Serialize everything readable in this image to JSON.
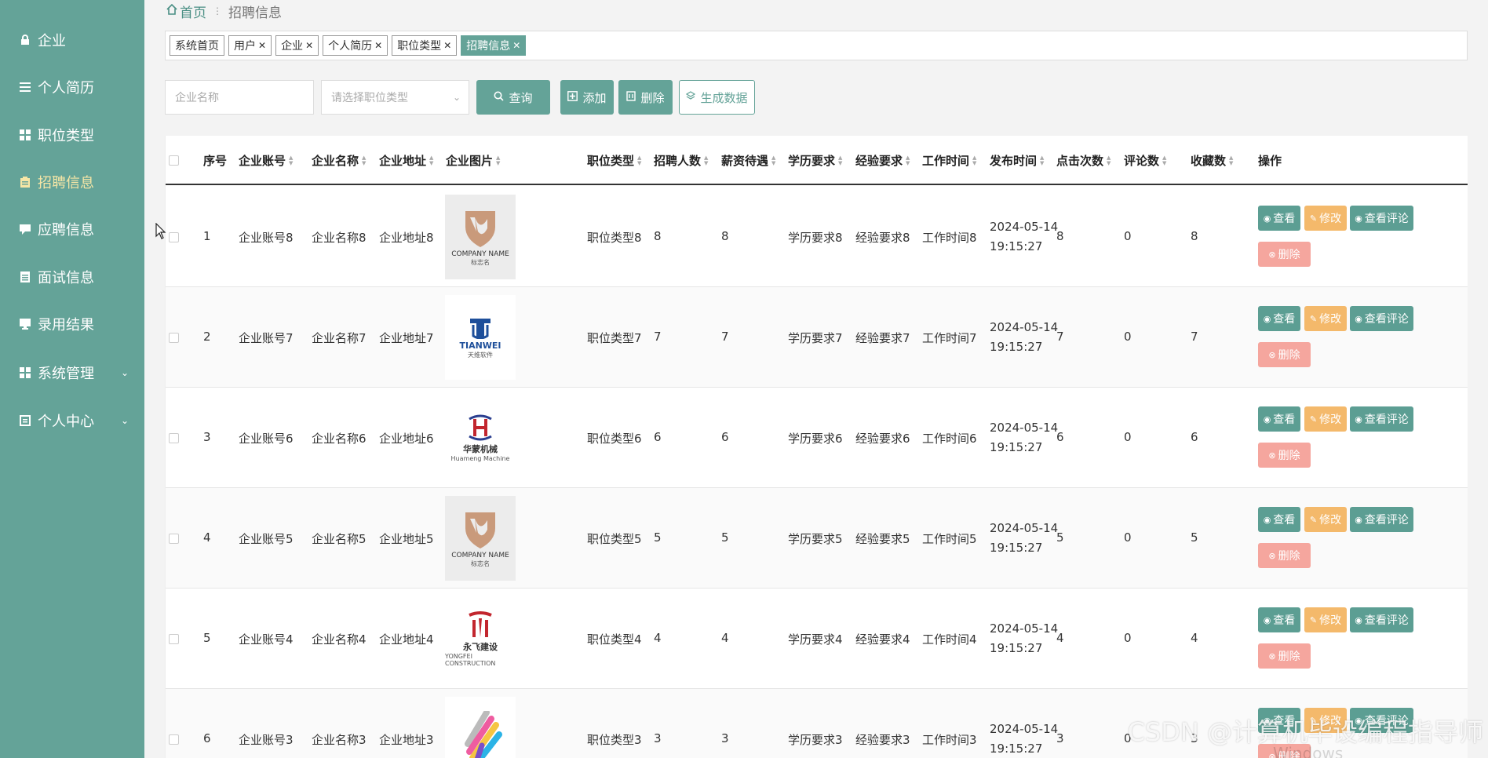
{
  "sidebar": {
    "items": [
      {
        "label": "企业",
        "icon": "lock-icon",
        "active": false
      },
      {
        "label": "个人简历",
        "icon": "list-icon",
        "active": false
      },
      {
        "label": "职位类型",
        "icon": "grid-icon",
        "active": false
      },
      {
        "label": "招聘信息",
        "icon": "clipboard-icon",
        "active": true
      },
      {
        "label": "应聘信息",
        "icon": "message-icon",
        "active": false
      },
      {
        "label": "面试信息",
        "icon": "document-icon",
        "active": false
      },
      {
        "label": "录用结果",
        "icon": "monitor-icon",
        "active": false
      },
      {
        "label": "系统管理",
        "icon": "grid-icon",
        "active": false,
        "expandable": true
      },
      {
        "label": "个人中心",
        "icon": "user-card-icon",
        "active": false,
        "expandable": true
      }
    ]
  },
  "breadcrumb": {
    "home": "首页",
    "current": "招聘信息"
  },
  "tags": [
    {
      "label": "系统首页",
      "closable": false,
      "active": false
    },
    {
      "label": "用户",
      "closable": true,
      "active": false
    },
    {
      "label": "企业",
      "closable": true,
      "active": false
    },
    {
      "label": "个人简历",
      "closable": true,
      "active": false
    },
    {
      "label": "职位类型",
      "closable": true,
      "active": false
    },
    {
      "label": "招聘信息",
      "closable": true,
      "active": true
    }
  ],
  "filters": {
    "company_placeholder": "企业名称",
    "type_placeholder": "请选择职位类型"
  },
  "buttons": {
    "search": "查询",
    "add": "添加",
    "delete": "删除",
    "generate": "生成数据"
  },
  "table": {
    "headers": {
      "index": "序号",
      "account": "企业账号",
      "name": "企业名称",
      "address": "企业地址",
      "image": "企业图片",
      "jobtype": "职位类型",
      "count": "招聘人数",
      "salary": "薪资待遇",
      "education": "学历要求",
      "experience": "经验要求",
      "worktime": "工作时间",
      "publish": "发布时间",
      "clicks": "点击次数",
      "comments": "评论数",
      "favorites": "收藏数",
      "ops": "操作"
    },
    "actions": {
      "view": "查看",
      "edit": "修改",
      "comment": "查看评论",
      "delete": "删除"
    },
    "rows": [
      {
        "index": "1",
        "account": "企业账号8",
        "name": "企业名称8",
        "address": "企业地址8",
        "logo": {
          "kind": "shield",
          "line1": "COMPANY NAME",
          "line2": "标志名"
        },
        "jobtype": "职位类型8",
        "count": "8",
        "salary": "8",
        "education": "学历要求8",
        "experience": "经验要求8",
        "worktime": "工作时间8",
        "publish": "2024-05-14 19:15:27",
        "clicks": "8",
        "comments": "0",
        "favorites": "8"
      },
      {
        "index": "2",
        "account": "企业账号7",
        "name": "企业名称7",
        "address": "企业地址7",
        "logo": {
          "kind": "tianwei",
          "line1": "TIANWEI",
          "line2": "天维软件"
        },
        "jobtype": "职位类型7",
        "count": "7",
        "salary": "7",
        "education": "学历要求7",
        "experience": "经验要求7",
        "worktime": "工作时间7",
        "publish": "2024-05-14 19:15:27",
        "clicks": "7",
        "comments": "0",
        "favorites": "7"
      },
      {
        "index": "3",
        "account": "企业账号6",
        "name": "企业名称6",
        "address": "企业地址6",
        "logo": {
          "kind": "huameng",
          "line1": "华蒙机械",
          "line2": "Huameng Machine"
        },
        "jobtype": "职位类型6",
        "count": "6",
        "salary": "6",
        "education": "学历要求6",
        "experience": "经验要求6",
        "worktime": "工作时间6",
        "publish": "2024-05-14 19:15:27",
        "clicks": "6",
        "comments": "0",
        "favorites": "6"
      },
      {
        "index": "4",
        "account": "企业账号5",
        "name": "企业名称5",
        "address": "企业地址5",
        "logo": {
          "kind": "shield",
          "line1": "COMPANY NAME",
          "line2": "标志名"
        },
        "jobtype": "职位类型5",
        "count": "5",
        "salary": "5",
        "education": "学历要求5",
        "experience": "经验要求5",
        "worktime": "工作时间5",
        "publish": "2024-05-14 19:15:27",
        "clicks": "5",
        "comments": "0",
        "favorites": "5"
      },
      {
        "index": "5",
        "account": "企业账号4",
        "name": "企业名称4",
        "address": "企业地址4",
        "logo": {
          "kind": "yongfei",
          "line1": "永飞建设",
          "line2": "YONGFEI CONSTRUCTION"
        },
        "jobtype": "职位类型4",
        "count": "4",
        "salary": "4",
        "education": "学历要求4",
        "experience": "经验要求4",
        "worktime": "工作时间4",
        "publish": "2024-05-14 19:15:27",
        "clicks": "4",
        "comments": "0",
        "favorites": "4"
      },
      {
        "index": "6",
        "account": "企业账号3",
        "name": "企业名称3",
        "address": "企业地址3",
        "logo": {
          "kind": "feather",
          "line1": "",
          "line2": ""
        },
        "jobtype": "职位类型3",
        "count": "3",
        "salary": "3",
        "education": "学历要求3",
        "experience": "经验要求3",
        "worktime": "工作时间3",
        "publish": "2024-05-14 19:15:27",
        "clicks": "3",
        "comments": "0",
        "favorites": "3"
      }
    ]
  },
  "watermark": "CSDN @计算机毕设编程指导师",
  "windows_mark": "Windows",
  "colors": {
    "primary": "#64a398",
    "active_sidebar_text": "#f6e6a6",
    "edit": "#f4b96b",
    "delete": "#f5a69e"
  }
}
